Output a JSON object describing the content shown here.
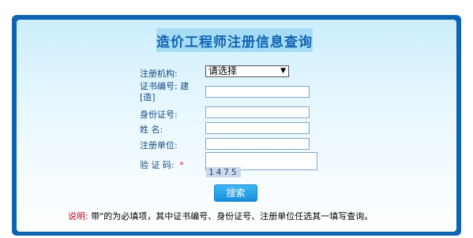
{
  "title": "造价工程师注册信息查询",
  "form": {
    "org_label": "注册机构:",
    "org_selected": "请选择",
    "cert_label_line1": "证书编号: 建",
    "cert_label_line2": "[造]",
    "id_label": "身份证号:",
    "name_label": "姓 名:",
    "unit_label": "注册单位:",
    "captcha_label": "验 证 码:",
    "captcha_required_mark": "*",
    "captcha_image_text": "1475",
    "search_button": "搜索"
  },
  "note": {
    "prefix": "说明:",
    "text": "带\"的为必填项，其中证书编号、身份证号、注册单位任选其一填写查询。"
  },
  "colors": {
    "frame": "#0e64b0",
    "title_bg": "#a6dcf6",
    "title_text": "#1063b0",
    "required": "#e2231a",
    "button": "#1a8fdc"
  },
  "icons": {
    "select_arrow": "dropdown-arrow-icon"
  }
}
